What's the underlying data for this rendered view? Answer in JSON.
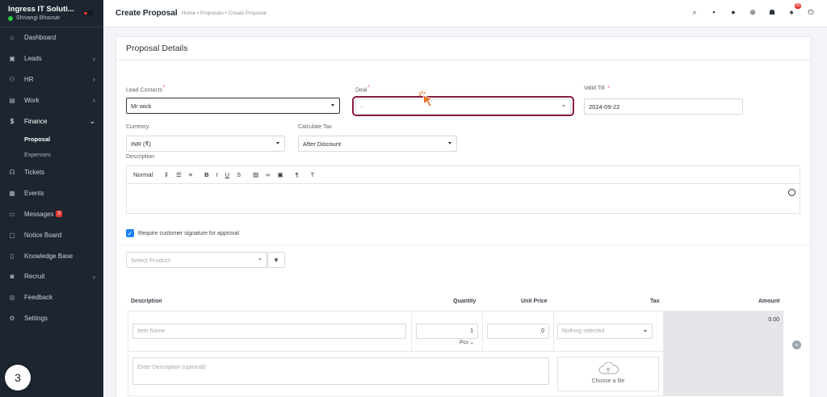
{
  "sidebar": {
    "company": "Ingress IT Soluti...",
    "user": "Shivangi Bhavsar",
    "items": [
      {
        "label": "Dashboard"
      },
      {
        "label": "Leads"
      },
      {
        "label": "HR"
      },
      {
        "label": "Work"
      },
      {
        "label": "Finance"
      },
      {
        "label": "Tickets"
      },
      {
        "label": "Events"
      },
      {
        "label": "Messages",
        "badge": "3"
      },
      {
        "label": "Notice Board"
      },
      {
        "label": "Knowledge Base"
      },
      {
        "label": "Recruit"
      },
      {
        "label": "Feedback"
      },
      {
        "label": "Settings"
      }
    ],
    "finance_sub": [
      "Proposal",
      "Expenses"
    ],
    "help_count": "3"
  },
  "header": {
    "title": "Create Proposal",
    "breadcrumb": "Home • Proposals • Create Proposal",
    "notification_count": "50"
  },
  "form": {
    "card_title": "Proposal Details",
    "lead_contacts_label": "Lead Contacts",
    "lead_contacts_value": "Mr wick",
    "deal_label": "Deal",
    "deal_value": "--",
    "valid_till_label": "Valid Till",
    "valid_till_value": "2024-09-22",
    "currency_label": "Currency",
    "currency_value": "INR (₹)",
    "calculate_tax_label": "Calculate Tax",
    "calculate_tax_value": "After Discount",
    "description_label": "Description",
    "editor_format": "Normal",
    "signature_label": "Require customer signature for approval",
    "select_product_placeholder": "Select Product"
  },
  "items_table": {
    "headers": {
      "description": "Description",
      "quantity": "Quantity",
      "unit_price": "Unit Price",
      "tax": "Tax",
      "amount": "Amount"
    },
    "row": {
      "item_name_placeholder": "Item Name",
      "quantity": "1",
      "unit": "Pcs",
      "unit_price": "0",
      "tax": "Nothing selected",
      "amount": "0.00",
      "description_placeholder": "Enter Description (optional)",
      "file_label": "Choose a file"
    }
  },
  "colors": {
    "sidebar_bg": "#1d2630",
    "accent": "#1d82f5",
    "focus_ring": "#8b1e3f",
    "cursor": "#e8722a"
  }
}
